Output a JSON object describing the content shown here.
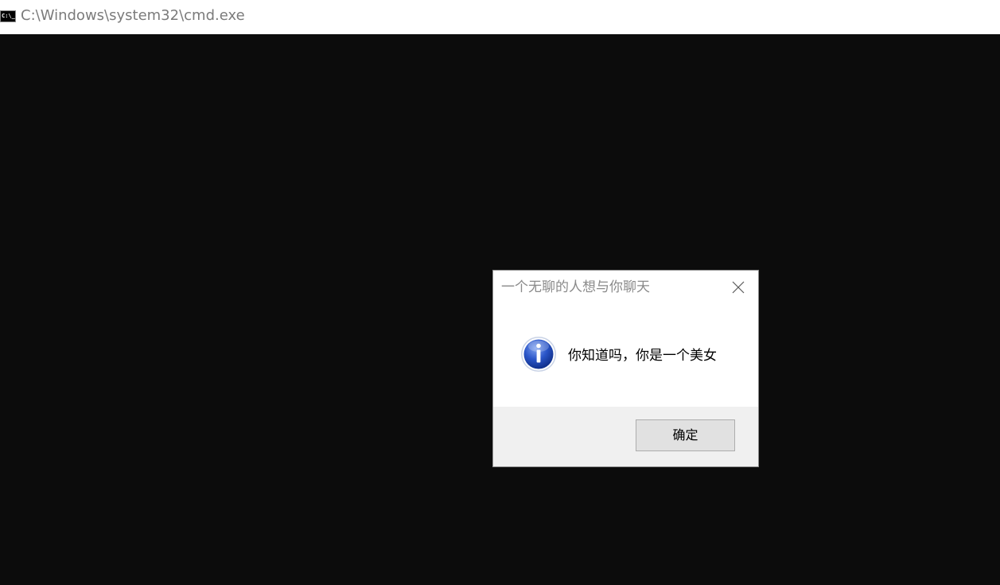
{
  "window": {
    "title": "C:\\Windows\\system32\\cmd.exe",
    "icon": "cmd-console-icon",
    "icon_glyph": "C:\\_",
    "console_background": "#0c0c0c"
  },
  "dialog": {
    "title": "一个无聊的人想与你聊天",
    "message": "你知道吗，你是一个美女",
    "icon": "information-icon",
    "close_icon": "close-icon",
    "ok_label": "确定"
  }
}
